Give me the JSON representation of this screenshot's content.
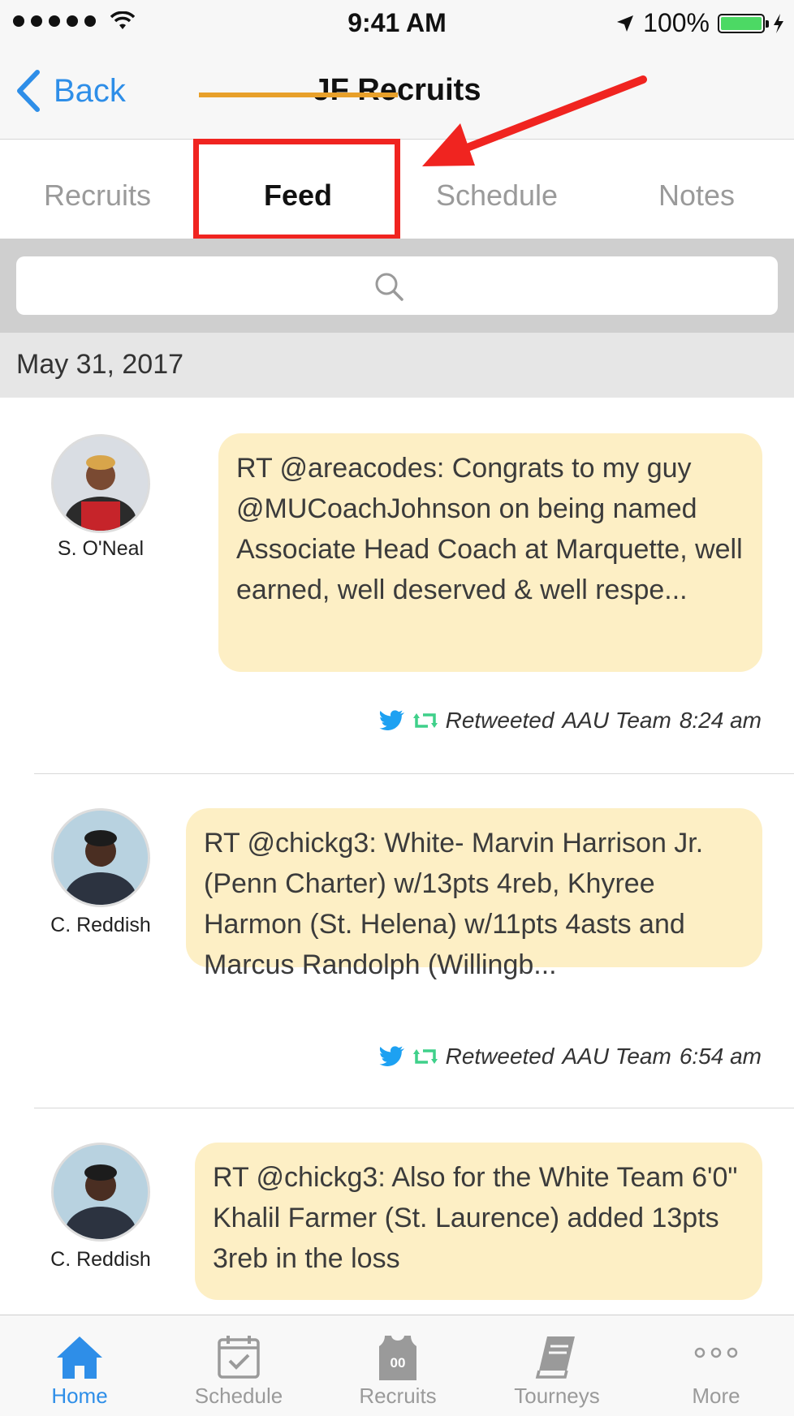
{
  "status_bar": {
    "time": "9:41 AM",
    "battery": "100%",
    "battery_level": 1.0
  },
  "nav": {
    "back_label": "Back",
    "title": "JF Recruits"
  },
  "tabs": [
    {
      "label": "Recruits",
      "active": false
    },
    {
      "label": "Feed",
      "active": true
    },
    {
      "label": "Schedule",
      "active": false
    },
    {
      "label": "Notes",
      "active": false
    }
  ],
  "search": {
    "placeholder": ""
  },
  "feed": {
    "date": "May 31, 2017",
    "items": [
      {
        "author": "S. O'Neal",
        "text": "RT @areacodes: Congrats to my guy @MUCoachJohnson on being named Associate Head Coach at Marquette, well earned, well deserved & well respe...",
        "action": "Retweeted",
        "team": "AAU Team",
        "time": "8:24 am"
      },
      {
        "author": "C. Reddish",
        "text": "RT @chickg3: White- Marvin Harrison Jr. (Penn Charter) w/13pts 4reb, Khyree Harmon (St. Helena) w/11pts 4asts and Marcus Randolph (Willingb...",
        "action": "Retweeted",
        "team": "AAU Team",
        "time": "6:54 am"
      },
      {
        "author": "C. Reddish",
        "text": "RT @chickg3: Also for the White Team 6'0\" Khalil Farmer (St. Laurence) added 13pts 3reb in the loss"
      }
    ]
  },
  "tabbar": [
    {
      "label": "Home",
      "icon": "home-icon",
      "active": true
    },
    {
      "label": "Schedule",
      "icon": "calendar-icon",
      "active": false
    },
    {
      "label": "Recruits",
      "icon": "jersey-icon",
      "jersey_number": "00",
      "active": false
    },
    {
      "label": "Tourneys",
      "icon": "book-icon",
      "active": false
    },
    {
      "label": "More",
      "icon": "more-icon",
      "active": false
    }
  ],
  "colors": {
    "accent": "#2e8ee8",
    "bubble": "#fdefc5",
    "highlight": "#f02420",
    "tab_underline": "#e8a02a",
    "twitter": "#1da1f2",
    "retweet": "#3fd08a"
  }
}
